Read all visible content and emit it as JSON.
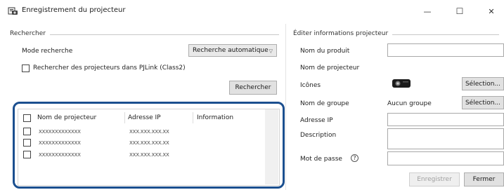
{
  "window": {
    "title": "Enregistrement du projecteur",
    "minimize_glyph": "—",
    "maximize_glyph": "☐",
    "close_glyph": "✕"
  },
  "search": {
    "group_label": "Rechercher",
    "mode_label": "Mode recherche",
    "mode_value": "Recherche automatique",
    "pjlink_label": "Rechercher des projecteurs dans PJLink (Class2)",
    "search_button": "Rechercher"
  },
  "results_table": {
    "columns": [
      "Nom de projecteur",
      "Adresse IP",
      "Information"
    ],
    "rows": [
      {
        "name": "XXXXXXXXXXXXX",
        "ip": "XXX.XXX.XXX.XX",
        "info": ""
      },
      {
        "name": "XXXXXXXXXXXXX",
        "ip": "XXX.XXX.XXX.XX",
        "info": ""
      },
      {
        "name": "XXXXXXXXXXXXX",
        "ip": "XXX.XXX.XXX.XX",
        "info": ""
      }
    ]
  },
  "edit": {
    "group_label": "Éditer informations projecteur",
    "product_name_label": "Nom du produit",
    "product_name_value": "",
    "projector_name_label": "Nom de projecteur",
    "icons_label": "Icônes",
    "select_button": "Sélection...",
    "group_name_label": "Nom de groupe",
    "group_name_value": "Aucun groupe",
    "group_select_button": "Sélection...",
    "ip_label": "Adresse IP",
    "description_label": "Description",
    "password_label": "Mot de passe",
    "help_glyph": "?",
    "register_button": "Enregistrer",
    "close_button": "Fermer"
  },
  "colors": {
    "highlight_border": "#1b4f8f",
    "button_face": "#e1e1e1",
    "projector_icon": "#1c1c1c"
  },
  "icons": [
    "projector-register-icon",
    "minimize-icon",
    "maximize-icon",
    "close-icon",
    "chevron-down-icon",
    "projector-icon",
    "help-icon"
  ]
}
